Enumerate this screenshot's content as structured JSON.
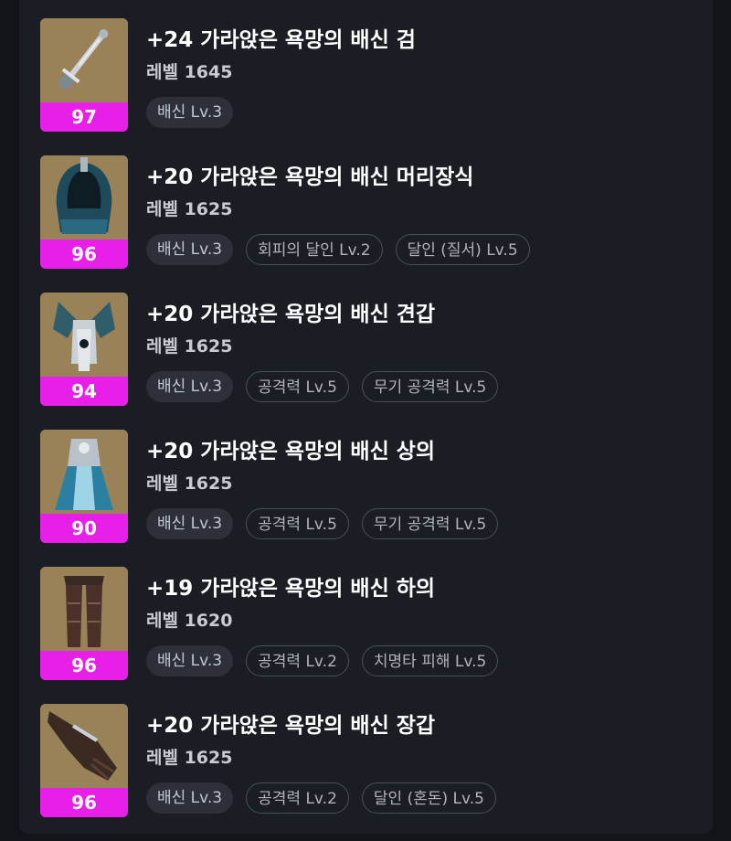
{
  "colors": {
    "quality_badge": "#e81fe9",
    "panel_bg": "#1b1d24",
    "page_bg": "#131419"
  },
  "items": [
    {
      "icon": "sword-icon",
      "name": "+24 가라앉은 욕망의 배신 검",
      "level": "레벨 1645",
      "quality": "97",
      "tags": [
        "배신 Lv.3"
      ]
    },
    {
      "icon": "helmet-icon",
      "name": "+20 가라앉은 욕망의 배신 머리장식",
      "level": "레벨 1625",
      "quality": "96",
      "tags": [
        "배신 Lv.3",
        "회피의 달인 Lv.2",
        "달인 (질서) Lv.5"
      ]
    },
    {
      "icon": "shoulder-armor-icon",
      "name": "+20 가라앉은 욕망의 배신 견갑",
      "level": "레벨 1625",
      "quality": "94",
      "tags": [
        "배신 Lv.3",
        "공격력 Lv.5",
        "무기 공격력 Lv.5"
      ]
    },
    {
      "icon": "chest-armor-icon",
      "name": "+20 가라앉은 욕망의 배신 상의",
      "level": "레벨 1625",
      "quality": "90",
      "tags": [
        "배신 Lv.3",
        "공격력 Lv.5",
        "무기 공격력 Lv.5"
      ]
    },
    {
      "icon": "leg-armor-icon",
      "name": "+19 가라앉은 욕망의 배신 하의",
      "level": "레벨 1620",
      "quality": "96",
      "tags": [
        "배신 Lv.3",
        "공격력 Lv.2",
        "치명타 피해 Lv.5"
      ]
    },
    {
      "icon": "glove-icon",
      "name": "+20 가라앉은 욕망의 배신 장갑",
      "level": "레벨 1625",
      "quality": "96",
      "tags": [
        "배신 Lv.3",
        "공격력 Lv.2",
        "달인 (혼돈) Lv.5"
      ]
    }
  ]
}
